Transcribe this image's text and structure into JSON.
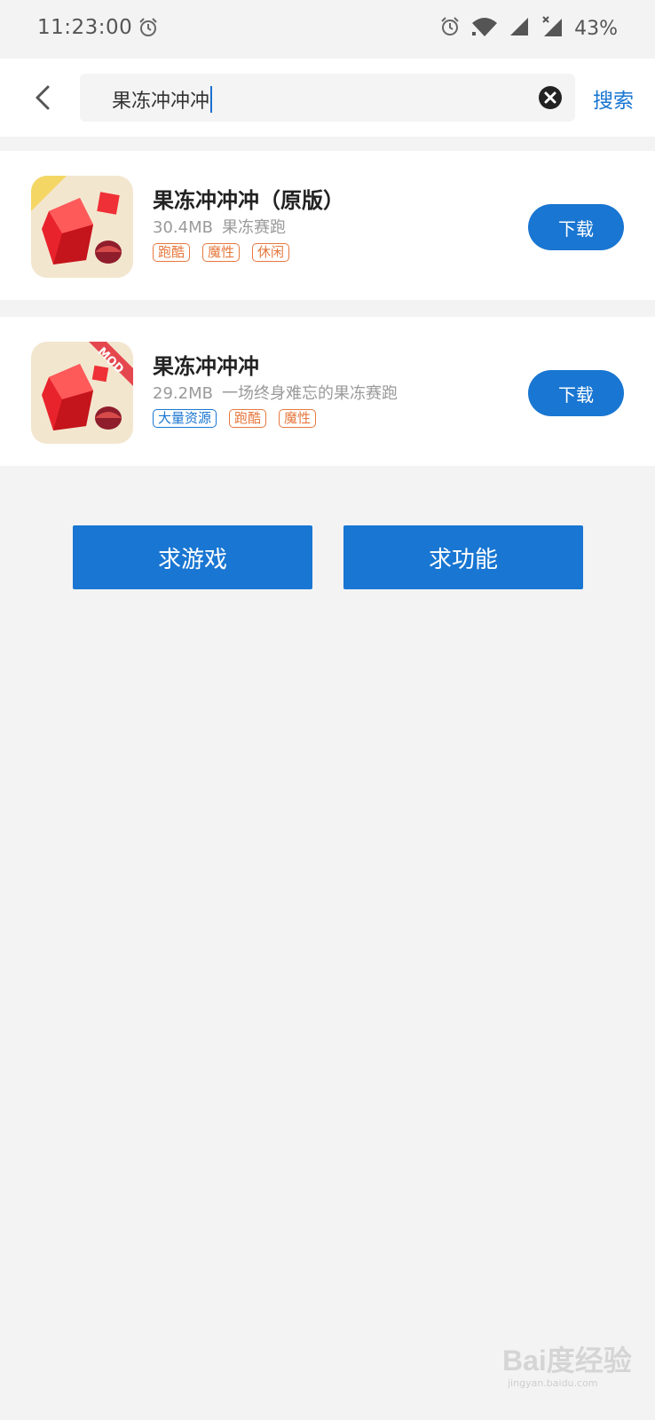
{
  "status_bar": {
    "time": "11:23:00",
    "battery": "43%",
    "icons": [
      "alarm-icon",
      "wifi-icon",
      "signal-icon",
      "signal-no-data-icon"
    ]
  },
  "search": {
    "query": "果冻冲冲冲",
    "submit_label": "搜索",
    "icons": [
      "back-icon",
      "clear-icon"
    ]
  },
  "results": [
    {
      "title": "果冻冲冲冲（原版）",
      "size": "30.4MB",
      "desc": "果冻赛跑",
      "tags": [
        "跑酷",
        "魔性",
        "休闲"
      ],
      "download_label": "下载"
    },
    {
      "title": "果冻冲冲冲",
      "size": "29.2MB",
      "desc": "一场终身难忘的果冻赛跑",
      "tags": [
        "大量资源",
        "跑酷",
        "魔性"
      ],
      "badge": "MOD",
      "download_label": "下载"
    }
  ],
  "actions": {
    "request_game": "求游戏",
    "request_feature": "求功能"
  },
  "watermark": {
    "text": "Bai度经验",
    "sub": "jingyan.baidu.com"
  },
  "colors": {
    "accent": "#1976d2",
    "tag_orange": "#e6783d",
    "background": "#f3f3f3"
  }
}
